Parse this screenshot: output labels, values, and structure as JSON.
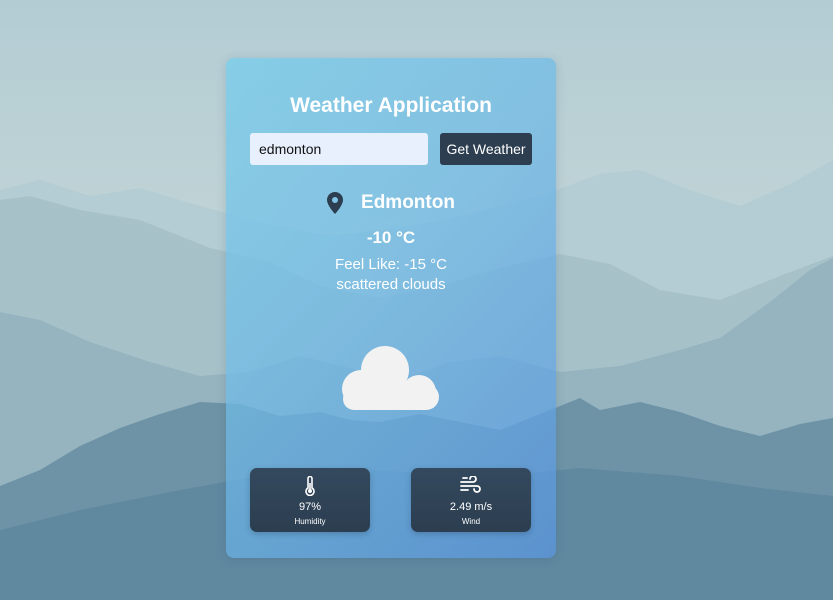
{
  "app": {
    "title": "Weather Application"
  },
  "search": {
    "value": "edmonton",
    "button_label": "Get Weather"
  },
  "weather": {
    "city": "Edmonton",
    "temperature": "-10 °C",
    "feels_like": "Feel Like: -15 °C",
    "description": "scattered clouds",
    "condition_icon": "cloud-icon"
  },
  "stats": {
    "humidity": {
      "value": "97%",
      "label": "Humidity",
      "icon": "thermometer-icon"
    },
    "wind": {
      "value": "2.49 m/s",
      "label": "Wind",
      "icon": "wind-icon"
    }
  },
  "colors": {
    "card_gradient_start": "#78cdeb",
    "card_gradient_end": "#5a96e1",
    "button_bg": "#2c3e50",
    "stat_box_bg": "#2c3e50",
    "input_bg": "#e8f0fe",
    "text": "#ffffff"
  }
}
